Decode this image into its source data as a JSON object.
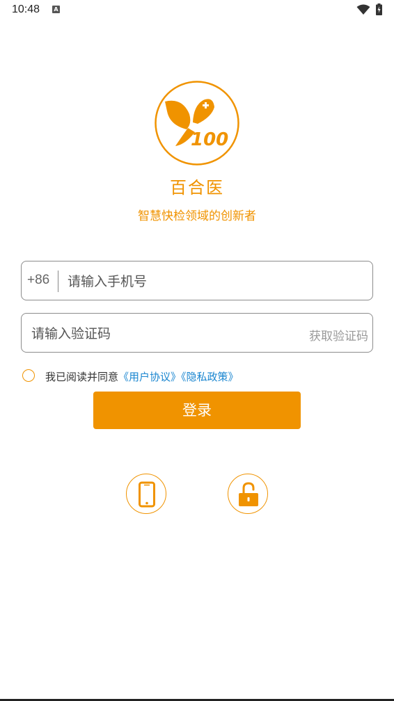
{
  "status_bar": {
    "time": "10:48",
    "notification_icon": "A"
  },
  "brand": {
    "logo_text": "100",
    "app_name": "百合医",
    "slogan": "智慧快检领域的创新者",
    "accent_color": "#f09300"
  },
  "phone_field": {
    "country_code": "+86",
    "placeholder": "请输入手机号",
    "value": ""
  },
  "code_field": {
    "placeholder": "请输入验证码",
    "value": "",
    "get_code_label": "获取验证码"
  },
  "agreement": {
    "prefix": "我已阅读并同意",
    "user_agreement": "《用户协议》",
    "privacy_policy": "《隐私政策》",
    "checked": false
  },
  "login": {
    "label": "登录"
  },
  "alt_login": {
    "phone_icon": "smartphone-icon",
    "password_icon": "unlock-icon"
  }
}
